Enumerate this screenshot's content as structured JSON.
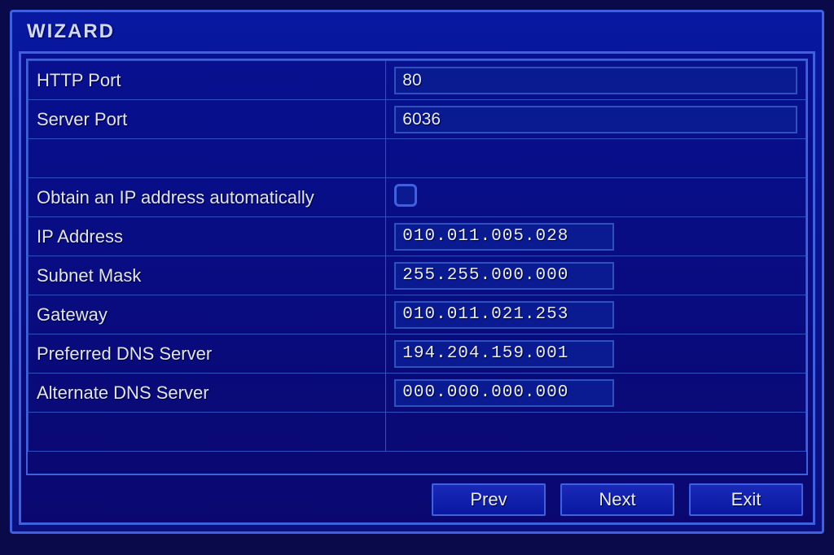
{
  "window": {
    "title": "WIZARD"
  },
  "fields": {
    "http_port": {
      "label": "HTTP Port",
      "value": "80"
    },
    "server_port": {
      "label": "Server Port",
      "value": "6036"
    },
    "dhcp": {
      "label": "Obtain an IP address automatically",
      "checked": false
    },
    "ip_address": {
      "label": "IP Address",
      "value": "010.011.005.028"
    },
    "subnet_mask": {
      "label": "Subnet Mask",
      "value": "255.255.000.000"
    },
    "gateway": {
      "label": "Gateway",
      "value": "010.011.021.253"
    },
    "preferred_dns": {
      "label": "Preferred DNS Server",
      "value": "194.204.159.001"
    },
    "alternate_dns": {
      "label": "Alternate DNS Server",
      "value": "000.000.000.000"
    }
  },
  "buttons": {
    "prev": "Prev",
    "next": "Next",
    "exit": "Exit"
  }
}
